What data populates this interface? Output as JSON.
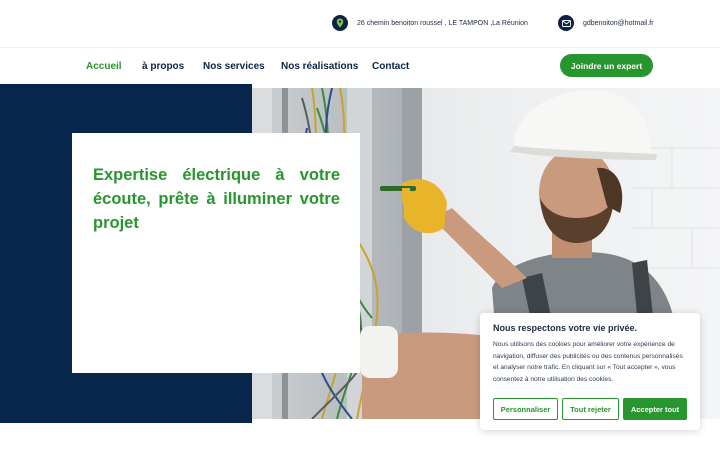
{
  "contact": {
    "address": "26 chemin benoiton roussel , LE TAMPON ,La Réunion",
    "address_icon": "map-pin-icon",
    "email": "gdbenoiton@hotmail.fr",
    "email_icon": "mail-icon"
  },
  "nav": {
    "items": [
      {
        "label": "Accueil",
        "active": true
      },
      {
        "label": "à propos",
        "active": false
      },
      {
        "label": "Nos services",
        "active": false
      },
      {
        "label": "Nos réalisations",
        "active": false
      },
      {
        "label": "Contact",
        "active": false
      }
    ],
    "cta_label": "Joindre un expert"
  },
  "hero": {
    "title": "Expertise électrique à votre écoute, prête à illuminer votre projet"
  },
  "cookie": {
    "title": "Nous respectons votre vie privée.",
    "text": "Nous utilisons des cookies pour améliorer votre expérience de navigation, diffuser des publicités ou des contenus personnalisés et analyser notre trafic. En cliquant sur « Tout accepter », vous consentez à notre utilisation des cookies.",
    "customize_label": "Personnaliser",
    "reject_label": "Tout rejeter",
    "accept_label": "Accepter tout"
  },
  "colors": {
    "brand_green": "#27962e",
    "navy": "#08264c"
  }
}
